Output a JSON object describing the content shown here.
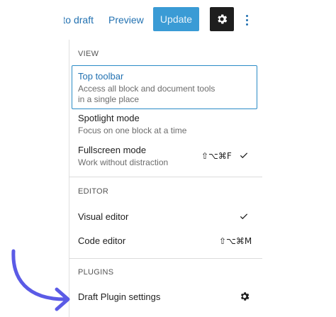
{
  "toolbar": {
    "switch_to_draft_label": "Switch to draft",
    "preview_label": "Preview",
    "update_label": "Update",
    "settings_icon": "gear-icon",
    "more_icon": "vertical-ellipsis-icon"
  },
  "menu": {
    "view": {
      "label": "VIEW",
      "items": [
        {
          "title": "Top toolbar",
          "description_line1": "Access all block and document tools",
          "description_line2": "in a single place"
        },
        {
          "title": "Spotlight mode",
          "description": "Focus on one block at a time"
        },
        {
          "title": "Fullscreen mode",
          "description": "Work without distraction",
          "shortcut": "⇧⌥⌘F",
          "checked": true
        }
      ]
    },
    "editor": {
      "label": "EDITOR",
      "items": [
        {
          "title": "Visual editor",
          "checked": true
        },
        {
          "title": "Code editor",
          "shortcut": "⇧⌥⌘M"
        }
      ]
    },
    "plugins": {
      "label": "PLUGINS",
      "items": [
        {
          "title": "Draft Plugin settings",
          "icon": "gear-icon"
        }
      ]
    }
  },
  "colors": {
    "accent": "#2271b1",
    "update_button": "#3a9bd5",
    "selection_border": "#2a8bc6",
    "annotation_arrow": "#5b5be6"
  }
}
